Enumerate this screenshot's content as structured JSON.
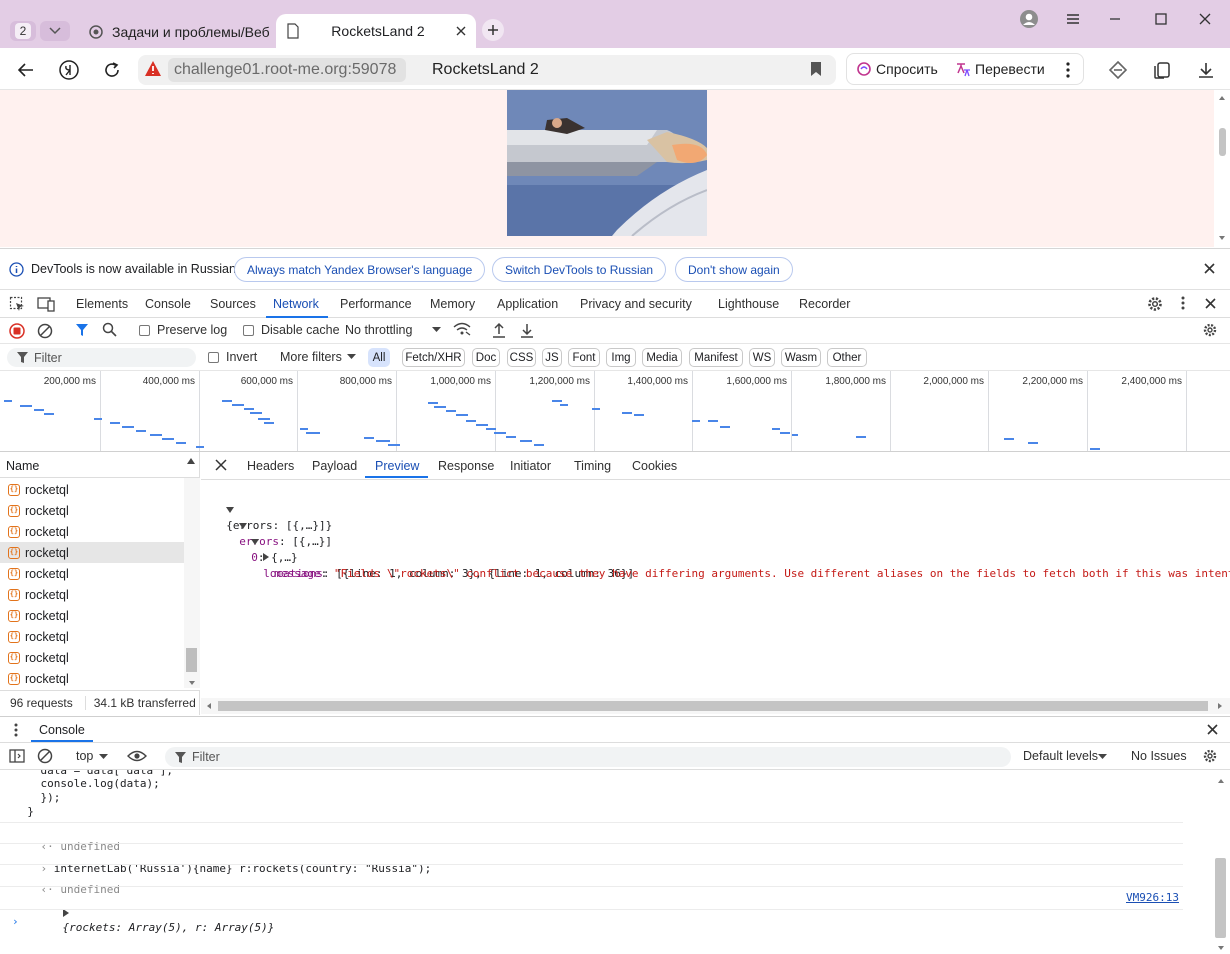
{
  "browser": {
    "tab_count": "2",
    "tabs": [
      {
        "label": "Задачи и проблемы/Веб"
      },
      {
        "label": "RocketsLand 2"
      }
    ],
    "url_host": "challenge01.root-me.org:59078",
    "page_title": "RocketsLand 2",
    "actions": {
      "ask": "Спросить",
      "translate": "Перевести"
    }
  },
  "banner": {
    "message": "DevTools is now available in Russian!",
    "buttons": [
      "Always match Yandex Browser's language",
      "Switch DevTools to Russian",
      "Don't show again"
    ]
  },
  "devtools": {
    "tabs": [
      "Elements",
      "Console",
      "Sources",
      "Network",
      "Performance",
      "Memory",
      "Application",
      "Privacy and security",
      "Lighthouse",
      "Recorder"
    ],
    "active_tab": "Network"
  },
  "network": {
    "preserve_log": "Preserve log",
    "disable_cache": "Disable cache",
    "throttling": "No throttling",
    "filter_placeholder": "Filter",
    "invert": "Invert",
    "more_filters": "More filters",
    "type_filters": [
      "All",
      "Fetch/XHR",
      "Doc",
      "CSS",
      "JS",
      "Font",
      "Img",
      "Media",
      "Manifest",
      "WS",
      "Wasm",
      "Other"
    ],
    "timeline_ticks": [
      "200,000 ms",
      "400,000 ms",
      "600,000 ms",
      "800,000 ms",
      "1,000,000 ms",
      "1,200,000 ms",
      "1,400,000 ms",
      "1,600,000 ms",
      "1,800,000 ms",
      "2,000,000 ms",
      "2,200,000 ms",
      "2,400,000 ms"
    ],
    "name_header": "Name",
    "requests": [
      "rocketql",
      "rocketql",
      "rocketql",
      "rocketql",
      "rocketql",
      "rocketql",
      "rocketql",
      "rocketql",
      "rocketql",
      "rocketql"
    ],
    "selected_request_index": 3,
    "requests_count": "96 requests",
    "transferred": "34.1 kB transferred",
    "detail_tabs": [
      "Headers",
      "Payload",
      "Preview",
      "Response",
      "Initiator",
      "Timing",
      "Cookies"
    ],
    "active_detail_tab": "Preview",
    "preview": {
      "root": "{errors: [{,…}]}",
      "errors_key": "errors",
      "errors_val": "[{,…}]",
      "item_key": "0",
      "item_val": "{,…}",
      "locations_key": "locations",
      "locations_val": "[{line: 1, column: 3}, {line: 1, column: 36}]",
      "message_key": "message",
      "message_val": "\"Fields \\\"rockets\\\" conflict because they have differing arguments. Use different aliases on the fields to fetch both if this was intentio"
    }
  },
  "console": {
    "drawer_tab": "Console",
    "context": "top",
    "filter_placeholder": "Filter",
    "levels": "Default levels",
    "issues": "No Issues",
    "lines": {
      "code1": "    data = data['data'];",
      "code2": "    console.log(data);",
      "code3": "    });",
      "code4": "  }",
      "result1": "undefined",
      "input": "internetLab('Russia'){name} r:rockets(country: \"Russia\");",
      "result2": "undefined",
      "log": "{rockets: Array(5), r: Array(5)}",
      "log_source": "VM926:13"
    }
  },
  "colors": {
    "tabstrip": "#e3cde5",
    "accent": "#1a73e8",
    "page_bg": "#fff1ef"
  }
}
